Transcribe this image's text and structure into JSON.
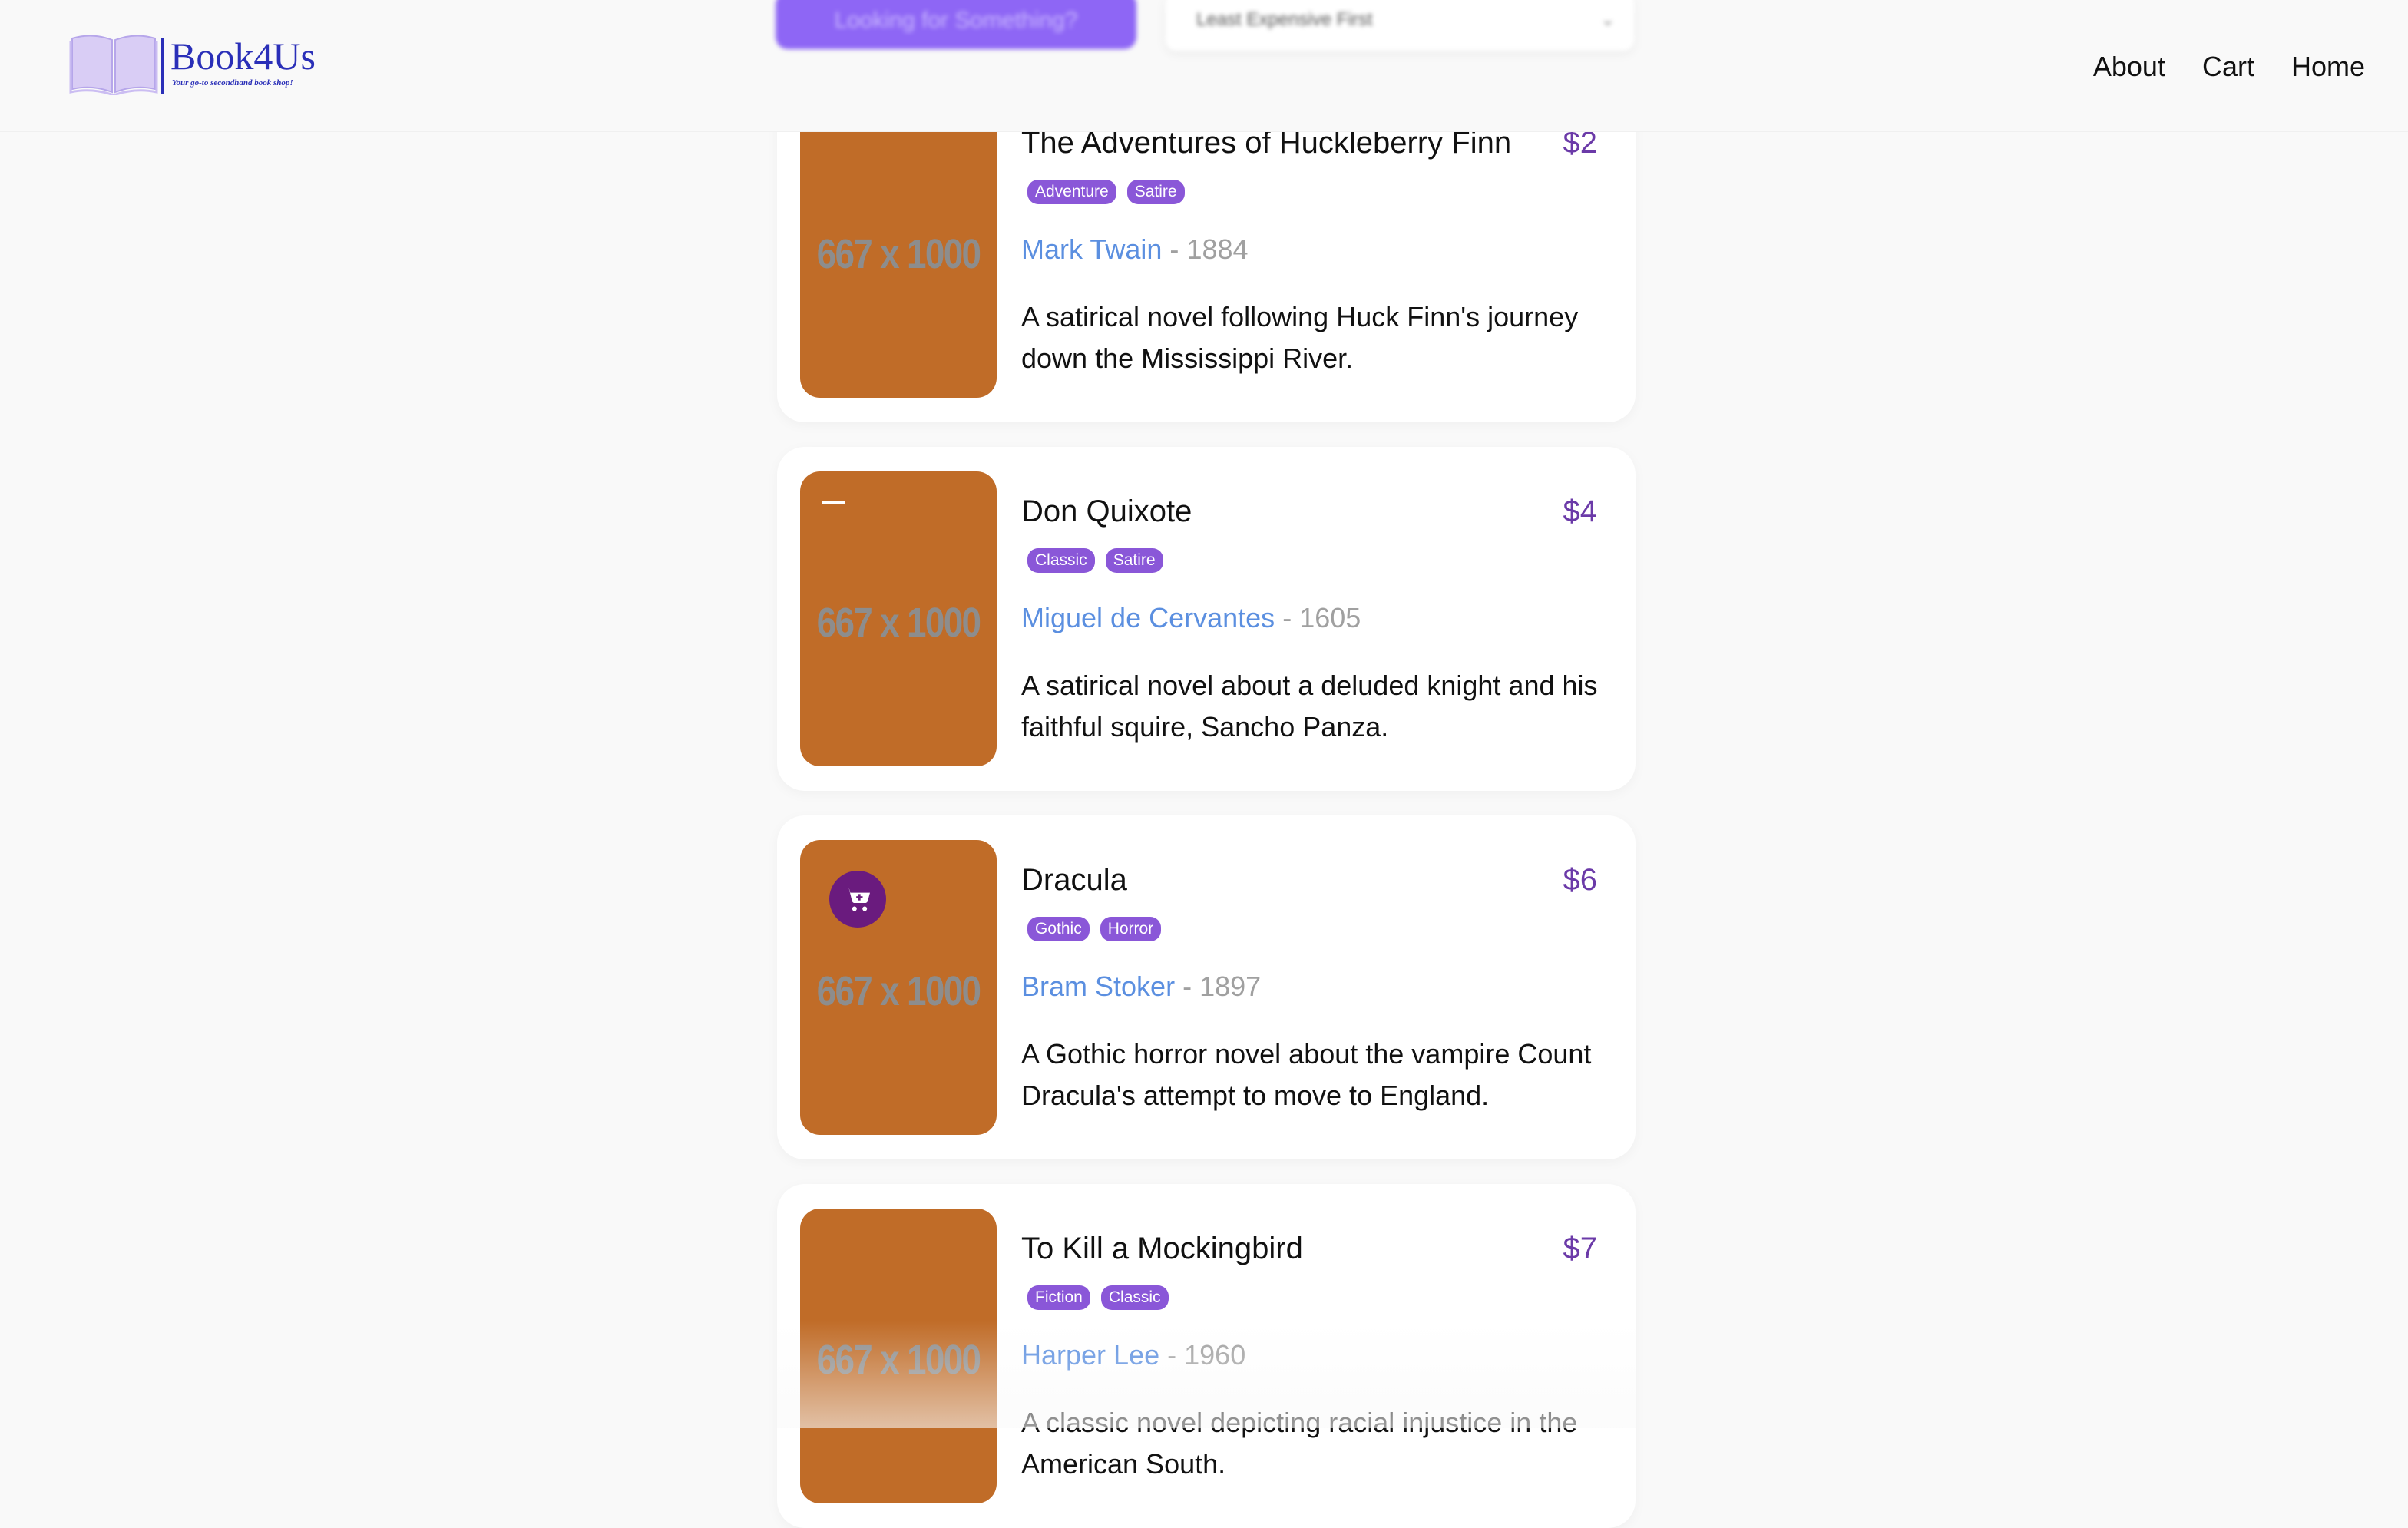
{
  "header": {
    "logo_name": "Book4Us",
    "logo_tagline": "Your go-to secondhand book shop!",
    "nav": [
      {
        "label": "About"
      },
      {
        "label": "Cart"
      },
      {
        "label": "Home"
      }
    ]
  },
  "search": {
    "button_label": "Looking for Something?",
    "sort_label": "Least Expensive First"
  },
  "books": [
    {
      "title": "The Adventures of Huckleberry Finn",
      "price": "$2",
      "tags": [
        "Adventure",
        "Satire"
      ],
      "author": "Mark Twain",
      "year": "1884",
      "description": "A satirical novel following Huck Finn's journey down the Mississippi River.",
      "cover_text": "667 x 1000"
    },
    {
      "title": "Don Quixote",
      "price": "$4",
      "tags": [
        "Classic",
        "Satire"
      ],
      "author": "Miguel de Cervantes",
      "year": "1605",
      "description": "A satirical novel about a deluded knight and his faithful squire, Sancho Panza.",
      "cover_text": "667 x 1000"
    },
    {
      "title": "Dracula",
      "price": "$6",
      "tags": [
        "Gothic",
        "Horror"
      ],
      "author": "Bram Stoker",
      "year": "1897",
      "description": "A Gothic horror novel about the vampire Count Dracula's attempt to move to England.",
      "cover_text": "667 x 1000"
    },
    {
      "title": "To Kill a Mockingbird",
      "price": "$7",
      "tags": [
        "Fiction",
        "Classic"
      ],
      "author": "Harper Lee",
      "year": "1960",
      "description": "A classic novel depicting racial injustice in the American South.",
      "cover_text": "667 x 1000"
    }
  ],
  "separator": "-",
  "colors": {
    "brand": "#2a2fb8",
    "accent_purple": "#8a57d8",
    "price": "#6b3aa8",
    "author": "#5b8fe0",
    "cover": "#c06c28",
    "cart_button": "#6a1b7e"
  },
  "icons": {
    "logo": "open-book-icon",
    "add_to_cart": "cart-plus-icon"
  }
}
